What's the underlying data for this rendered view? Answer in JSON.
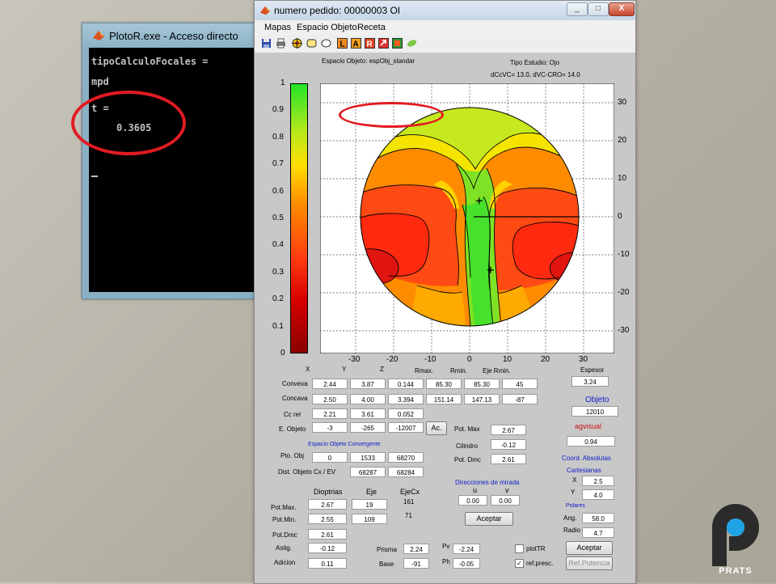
{
  "console": {
    "title": "PlotoR.exe - Acceso directo",
    "lines": [
      "tipoCalculoFocales =",
      "mpd",
      "t =",
      "0.3605"
    ]
  },
  "window": {
    "title": "numero pedido:  00000003 OI",
    "buttons": [
      "_",
      "□",
      "X"
    ]
  },
  "menu": [
    "Mapas",
    "Espacio Objeto",
    "Receta"
  ],
  "toolbar_icons": [
    "save-icon",
    "print-icon",
    "target-icon",
    "frame-icon",
    "ellipse-icon",
    "L-icon",
    "A-icon",
    "R-icon",
    "arrow-icon",
    "grid-icon",
    "leaf-icon"
  ],
  "plot": {
    "header_left": "Espacio Objeto: espObj_standar",
    "header_right": "Tipo Estudio:   Ojo",
    "header_sub": "dCcVC= 13.0, dVC-CRO= 14.0"
  },
  "colorbar_ticks": [
    "1",
    "0.9",
    "0.8",
    "0.7",
    "0.6",
    "0.5",
    "0.4",
    "0.3",
    "0.2",
    "0.1",
    "0"
  ],
  "chart_data": {
    "type": "heatmap",
    "x_ticks": [
      "-30",
      "-20",
      "-10",
      "0",
      "10",
      "20",
      "30"
    ],
    "y_ticks_right": [
      "30",
      "20",
      "10",
      "0",
      "-10",
      "-20",
      "-30"
    ],
    "xlim": [
      -38,
      38
    ],
    "ylim": [
      -38,
      38
    ],
    "colorbar_range": [
      0,
      1
    ],
    "colormap": [
      "#c00000",
      "#ff3b16",
      "#ff8a00",
      "#f7e000",
      "#a9e020",
      "#3fe02a"
    ],
    "crosses": [
      [
        2.5,
        4.2
      ],
      [
        5.5,
        -14
      ]
    ],
    "grid": true
  },
  "fields": {
    "headers": [
      "X",
      "Y",
      "Z",
      "Rmax.",
      "Rmin.",
      "Eje Rmin."
    ],
    "rows": [
      {
        "label": "Convexa",
        "values": [
          "2.44",
          "3.87",
          "0.144",
          "85.30",
          "85.30",
          "45"
        ]
      },
      {
        "label": "Concava",
        "values": [
          "2.50",
          "4.00",
          "3.394",
          "151.14",
          "147.13",
          "-87"
        ]
      },
      {
        "label": "Cc rel",
        "values": [
          "2.21",
          "3.61",
          "0.052"
        ]
      },
      {
        "label": "E. Objeto",
        "values": [
          "-3",
          "-265",
          "-12007"
        ]
      }
    ],
    "ac_button": "Ac.",
    "espesor_label": "Espesor",
    "espesor_value": "3.24",
    "objeto_label": "Objeto",
    "objeto_value": "12010",
    "agvisual_label": "agvisual",
    "agvisual_value": "0.94",
    "pot_max_label": "Pot. Max",
    "pot_max_value": "2.67",
    "cilindro_label": "Cilindro",
    "cilindro_value": "-0.12",
    "pot_dmc_label": "Pot. Dmc",
    "pot_dmc_value": "2.61",
    "eoc_title": "Espacio Objeto Convergente",
    "pto_obj_label": "Pto. Obj",
    "pto_obj_values": [
      "0",
      "1533",
      "68270"
    ],
    "dist_label": "Dist. Objeto Cx / EV",
    "dist_values": [
      "68287",
      "68284"
    ],
    "dirs_title": "Direcciones de mirada",
    "u_label": "u",
    "v_label": "v",
    "u_value": "0.00",
    "v_value": "0.00",
    "aceptar": "Aceptar",
    "coord_title": "Coord. Absolutas",
    "cart_title": "Cartesianas",
    "x_label": "X",
    "x_value": "2.5",
    "y_label": "Y",
    "y_value": "4.0",
    "pol_title": "Polares",
    "ang_label": "Ang.",
    "ang_value": "58.0",
    "radio_label": "Radio",
    "radio_value": "4.7",
    "aceptar2": "Aceptar",
    "ref_potencia": "Ref.Potencia",
    "diop_headers": [
      "Dioptrias",
      "Eje",
      "EjeCx"
    ],
    "pot_max2_label": "Pot.Max.",
    "pot_max2_values": [
      "2.67",
      "19",
      "161"
    ],
    "pot_min_label": "Pot.Min.",
    "pot_min_values": [
      "2.55",
      "109",
      "71"
    ],
    "pot_dmc2_label": "Pot.Dmc",
    "pot_dmc2_value": "2.61",
    "astig_label": "Astig.",
    "astig_value": "-0.12",
    "adicion_label": "Adicion",
    "adicion_value": "0.11",
    "prisma_label": "Prisma",
    "prisma_value": "2.24",
    "base_label": "Base",
    "base_value": "-91",
    "pv_label": "Pv",
    "pv_value": "-2.24",
    "ph_label": "Ph",
    "ph_value": "-0.05",
    "plottr_label": "plotTR",
    "refpresc_label": "ref.presc.",
    "refpresc_checked": "✓"
  },
  "logo": {
    "brand": "PRATS",
    "colors": {
      "dark": "#2b2b2b",
      "accent": "#1fa2e6"
    }
  }
}
